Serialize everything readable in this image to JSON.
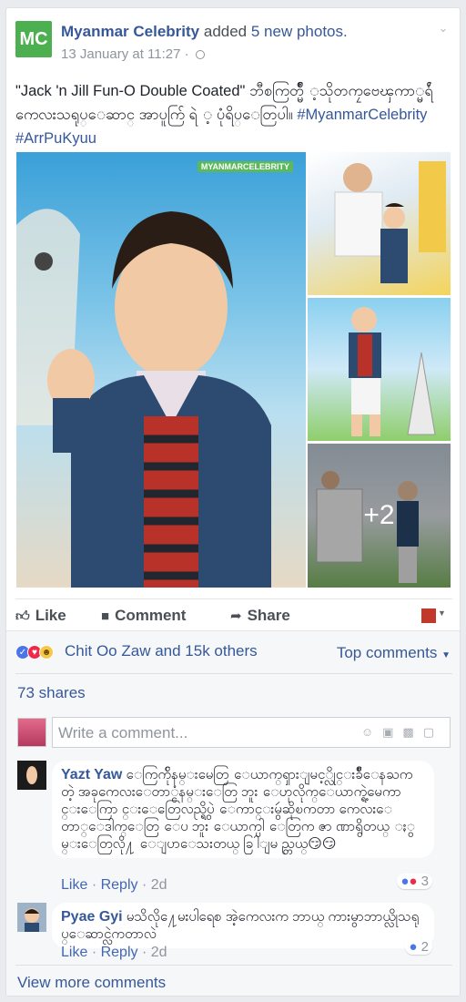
{
  "post": {
    "page_logo": "MC",
    "page_name": "Myanmar Celebrity",
    "action": "added",
    "action_link": "5 new photos.",
    "timestamp": "13 January at 11:27",
    "privacy_separator": "·",
    "text": "\"Jack 'n Jill Fun-O Double Coated\" ဘီစကြတ္မ်ိဳ ့သိုတကၠဗေၾကာ္မရ်ႆ ကေလးသရုပ္ေဆာင္ အာပူက်ြ ရဲ ့ ပုံရိပ္ေတြပါ။",
    "hashtags": [
      "#MyanmarCelebrity",
      "#ArrPuKyuu"
    ],
    "watermark": "MYANMARCELEBRITY",
    "more_photos": "+2"
  },
  "actions": {
    "like": "Like",
    "comment": "Comment",
    "share": "Share"
  },
  "reactions": {
    "summary": "Chit Oo Zaw and 15k others",
    "top_comments": "Top comments"
  },
  "shares": "73 shares",
  "compose": {
    "placeholder": "Write a comment..."
  },
  "comments": [
    {
      "name": "Yazt Yaw",
      "text": "ေကြက်ိုနမ္းမေတြ ေယာက္ၡားျမင့္လိုင္းခ်ိဳေနႀကတဲ့ အခုကေလးေတာ္ငံနမ္းေတြ ဘူး ေဟုလိုက္ေယာက္ရဲ့မေကာင္းေကြာ င္းေတြေလည္ရွိပဲ ေကာင္းမွဴဆိုၿကတာ ကေလးေတာ္ေဒါက္ေတြ ေပ ဘူး ေယာက္ပါ ေတြက ဇာ ဏာရွိတယ္ ႏွမ္းေတြလို႔ ေျပာေသးတယ္ ခြါျမ ည္တယ္😏😏",
      "like": "Like",
      "reply": "Reply",
      "time": "2d",
      "reaction_count": "3"
    },
    {
      "name": "Pyae Gyi",
      "text": "မသိလို႔ေမးပါရေစ အဲ့ကေလးက ဘာယ္ ကားမွာဘာယ္လိုသရုပ္ေဆာင္လဲကတာလဲ",
      "like": "Like",
      "reply": "Reply",
      "time": "2d",
      "reaction_count": "2"
    }
  ],
  "view_more": "View more comments",
  "colors": {
    "link": "#365899",
    "logo_green": "#4caf50",
    "background": "#e9ebee"
  }
}
